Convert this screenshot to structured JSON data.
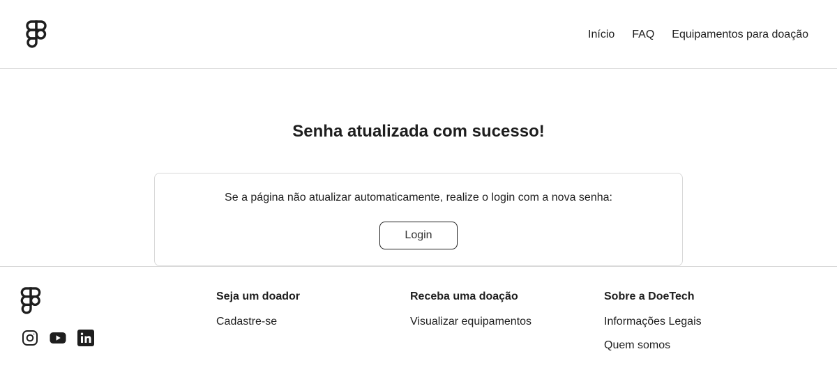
{
  "header": {
    "nav": {
      "home": "Início",
      "faq": "FAQ",
      "equipment": "Equipamentos para doação"
    }
  },
  "main": {
    "title": "Senha atualizada com sucesso!",
    "message": "Se a página não atualizar automaticamente, realize o login com a nova senha:",
    "login_label": "Login"
  },
  "footer": {
    "social": [
      "instagram-icon",
      "youtube-icon",
      "linkedin-icon"
    ],
    "columns": [
      {
        "heading": "Seja um doador",
        "links": [
          "Cadastre-se"
        ]
      },
      {
        "heading": "Receba uma doação",
        "links": [
          "Visualizar equipamentos"
        ]
      },
      {
        "heading": "Sobre a DoeTech",
        "links": [
          "Informações Legais",
          "Quem somos"
        ]
      }
    ]
  },
  "colors": {
    "text": "#1e1e1e",
    "border": "#d9d9d9",
    "background": "#ffffff"
  }
}
